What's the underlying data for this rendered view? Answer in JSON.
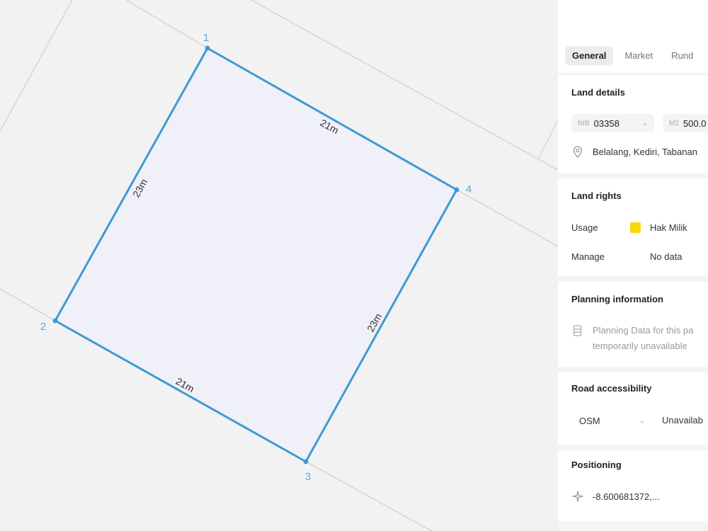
{
  "map": {
    "vertices": [
      {
        "label": "1"
      },
      {
        "label": "2"
      },
      {
        "label": "3"
      },
      {
        "label": "4"
      }
    ],
    "edges": [
      {
        "label": "21m"
      },
      {
        "label": "23m"
      },
      {
        "label": "21m"
      },
      {
        "label": "23m"
      }
    ],
    "colors": {
      "outline": "#3d9ad6",
      "fill": "#f0f0f8",
      "parcel_lines": "#d2d2d2"
    }
  },
  "panel": {
    "tabs": [
      {
        "label": "General",
        "active": true
      },
      {
        "label": "Market",
        "active": false
      },
      {
        "label": "Rund",
        "active": false
      }
    ],
    "land_details": {
      "title": "Land details",
      "nib_prefix": "NIB",
      "nib_value": "03358",
      "area_prefix": "M2",
      "area_value": "500.0",
      "location": "Belalang, Kediri, Tabanan"
    },
    "land_rights": {
      "title": "Land rights",
      "usage_label": "Usage",
      "usage_value": "Hak Milik",
      "usage_color": "#f5d90a",
      "manage_label": "Manage",
      "manage_value": "No data"
    },
    "planning": {
      "title": "Planning information",
      "line1": "Planning Data for this pa",
      "line2": "temporarily unavailable"
    },
    "road": {
      "title": "Road accessibility",
      "source": "OSM",
      "status": "Unavailab"
    },
    "positioning": {
      "title": "Positioning",
      "coords": "-8.600681372,..."
    }
  }
}
